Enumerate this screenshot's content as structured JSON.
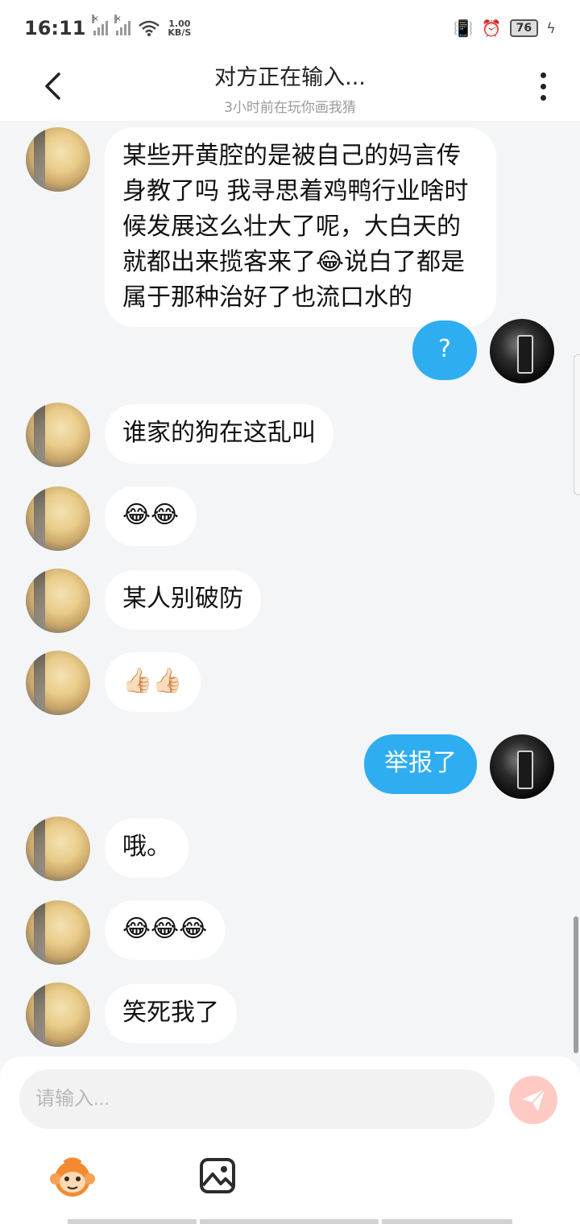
{
  "status_bar": {
    "time": "16:11",
    "net_speed_value": "1.00",
    "net_speed_unit": "KB/S",
    "battery": "76"
  },
  "header": {
    "title": "对方正在输入...",
    "subtitle": "3小时前在玩你画我猜"
  },
  "messages": [
    {
      "from": "other",
      "text": "某些开黄腔的是被自己的妈言传身教了吗 我寻思着鸡鸭行业啥时候发展这么壮大了呢，大白天的就都出来揽客来了😂说白了都是属于那种治好了也流口水的"
    },
    {
      "from": "me",
      "text": "?"
    },
    {
      "from": "other",
      "text": "谁家的狗在这乱叫"
    },
    {
      "from": "other",
      "text": "😂😂"
    },
    {
      "from": "other",
      "text": "某人别破防"
    },
    {
      "from": "other",
      "text": "👍🏻👍🏻"
    },
    {
      "from": "me",
      "text": "举报了"
    },
    {
      "from": "other",
      "text": "哦。"
    },
    {
      "from": "other",
      "text": "😂😂😂"
    },
    {
      "from": "other",
      "text": "笑死我了"
    }
  ],
  "input": {
    "placeholder": "请输入..."
  },
  "colors": {
    "mine_bubble": "#2eadf0",
    "other_bubble": "#ffffff",
    "background": "#f4f5f7",
    "send_button": "#ffc9c4"
  },
  "icons": {
    "back": "chevron-left-icon",
    "menu": "more-vertical-icon",
    "send": "paper-plane-icon",
    "emoji": "monkey-face-icon",
    "image": "image-icon"
  }
}
